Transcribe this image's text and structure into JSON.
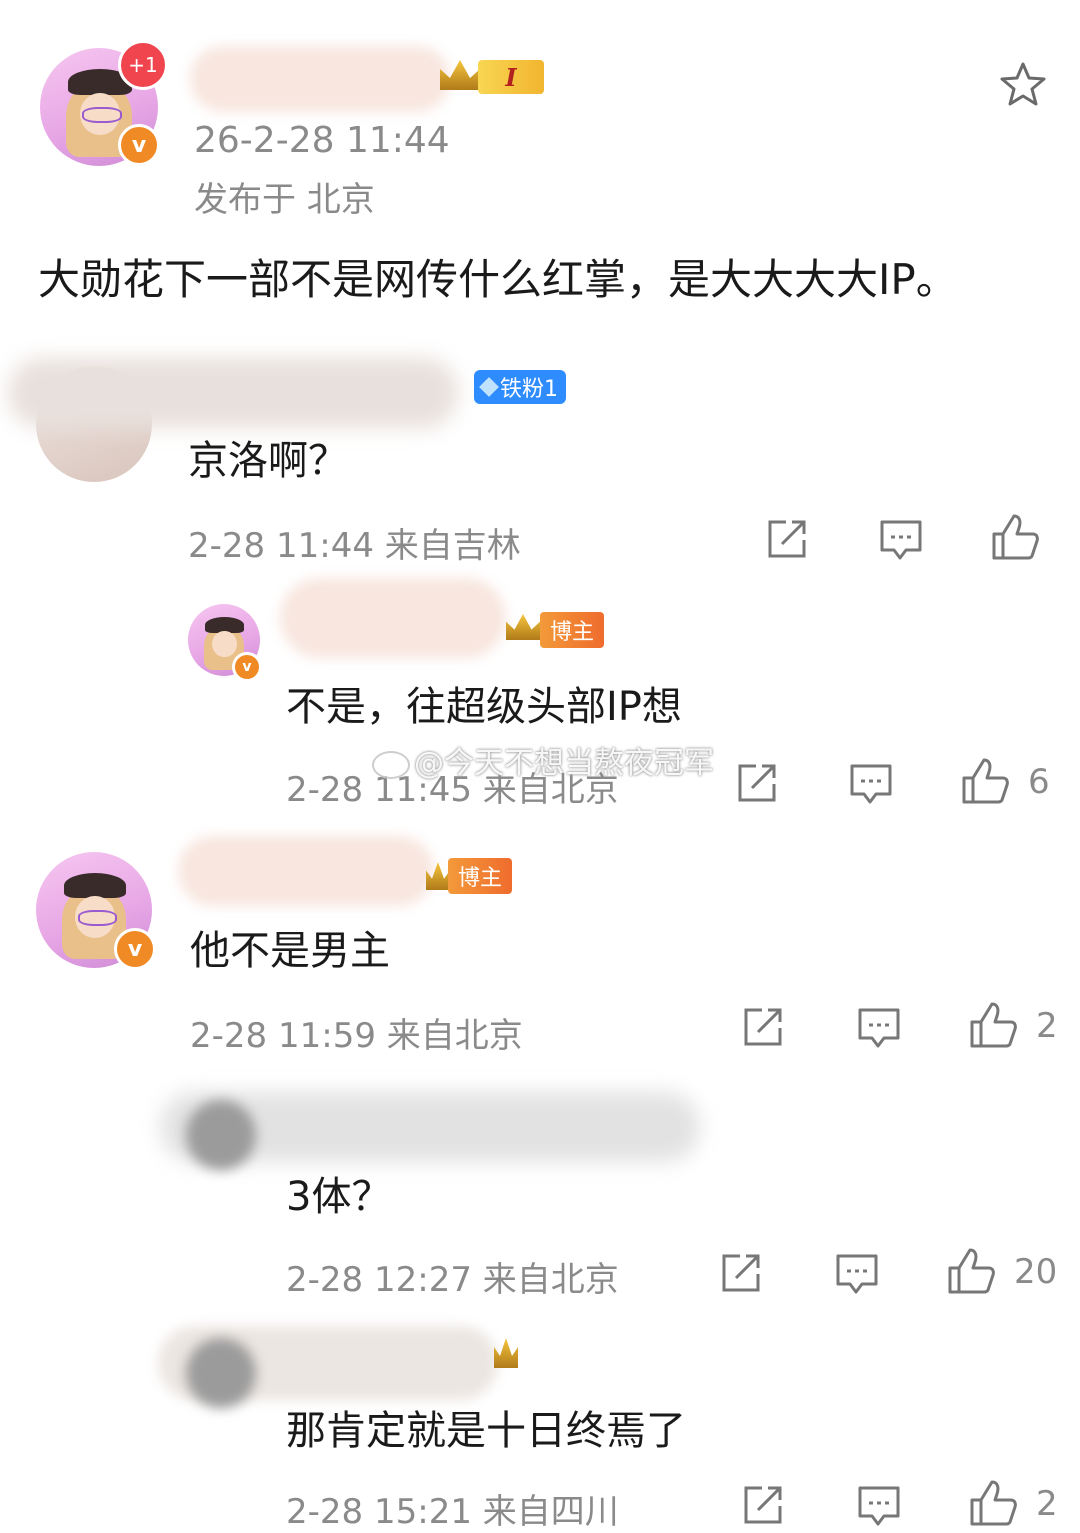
{
  "post": {
    "timestamp": "26-2-28 11:44",
    "location": "发布于 北京",
    "content": "大勋花下一部不是网传什么红掌，是大大大大IP。",
    "notify_badge": "+1",
    "level_badge": "I"
  },
  "watermark": "@今天不想当熬夜冠军",
  "comments": [
    {
      "badge": "铁粉1",
      "content": "京洛啊？",
      "meta": "2-28 11:44  来自吉林",
      "likes": ""
    },
    {
      "badge": "博主",
      "content": "不是，往超级头部IP想",
      "meta": "2-28 11:45  来自北京",
      "likes": "6"
    },
    {
      "badge": "博主",
      "content": "他不是男主",
      "meta": "2-28 11:59  来自北京",
      "likes": "2"
    },
    {
      "badge": "",
      "content": "3体？",
      "meta": "2-28 12:27  来自北京",
      "likes": "20"
    },
    {
      "badge": "",
      "content": "那肯定就是十日终焉了",
      "meta": "2-28 15:21  来自四川",
      "likes": "2"
    }
  ],
  "colors": {
    "accent_orange": "#f08a24",
    "badge_blue": "#2f8cff",
    "meta_gray": "#8a8a8a"
  }
}
